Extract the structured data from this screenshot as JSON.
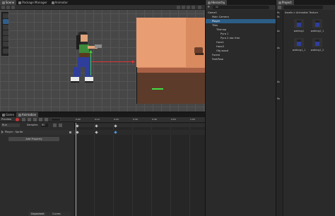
{
  "scene_tabs": [
    {
      "label": "Scene",
      "active": true
    },
    {
      "label": "Package Manager",
      "active": false
    },
    {
      "label": "Animator",
      "active": false
    }
  ],
  "animation_tabs": [
    {
      "label": "Game",
      "active": false
    },
    {
      "label": "Animation",
      "active": true
    }
  ],
  "animation": {
    "preview_label": "Preview",
    "clip_name": "Run",
    "samples_label": "Samples",
    "samples_value": "60",
    "property_row": "Player : Sprite",
    "add_property_label": "Add Property",
    "ruler_labels": [
      "0:00",
      "0:10",
      "0:20",
      "0:30",
      "0:40",
      "0:50",
      "1:00"
    ],
    "bottom_tabs": [
      "Dopesheet",
      "Curves"
    ]
  },
  "hierarchy": {
    "tab_label": "Hierarchy",
    "add_label": "+",
    "search_placeholder": "All",
    "items": [
      {
        "label": "Game1",
        "depth": 0,
        "selected": false
      },
      {
        "label": "Main Camera",
        "depth": 1,
        "selected": false
      },
      {
        "label": "Player",
        "depth": 1,
        "selected": true
      },
      {
        "label": "Tiles",
        "depth": 1,
        "selected": false
      },
      {
        "label": "Tilemap",
        "depth": 2,
        "selected": false
      },
      {
        "label": "Pyra 1",
        "depth": 3,
        "selected": false
      },
      {
        "label": "Pyra 2 doc free",
        "depth": 3,
        "selected": false
      },
      {
        "label": "Hora1",
        "depth": 2,
        "selected": false
      },
      {
        "label": "Hora3",
        "depth": 2,
        "selected": false
      },
      {
        "label": "Obj wood",
        "depth": 2,
        "selected": false
      },
      {
        "label": "Forest",
        "depth": 1,
        "selected": false
      },
      {
        "label": "FeetPose",
        "depth": 1,
        "selected": false
      }
    ]
  },
  "project": {
    "tab_label": "Project",
    "breadcrumb": [
      "Assets",
      "Animation Texture"
    ],
    "sidebar_items": [
      "Fa",
      "Fa",
      "As",
      "As",
      "As",
      "Pa"
    ],
    "assets": [
      {
        "name": "walking1"
      },
      {
        "name": "walking2_1"
      },
      {
        "name": "walking1_1"
      },
      {
        "name": "walking1_2"
      }
    ]
  }
}
